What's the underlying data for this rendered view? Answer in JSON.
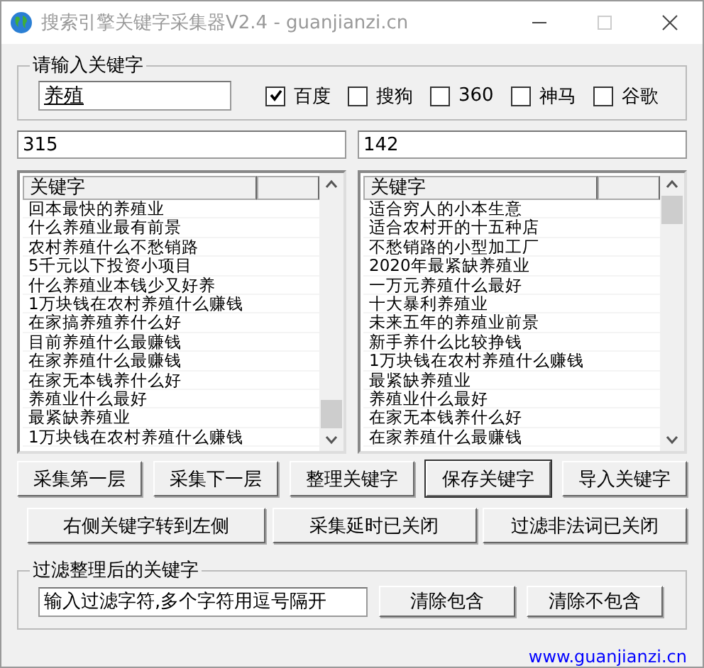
{
  "window": {
    "title": "搜索引擎关键字采集器V2.4 - guanjianzi.cn"
  },
  "keyword_group": {
    "legend": "请输入关键字",
    "value": "养殖",
    "engines": [
      {
        "label": "百度",
        "checked": true
      },
      {
        "label": "搜狗",
        "checked": false
      },
      {
        "label": "360",
        "checked": false
      },
      {
        "label": "神马",
        "checked": false
      },
      {
        "label": "谷歌",
        "checked": false
      }
    ]
  },
  "counts": [
    "315",
    "142"
  ],
  "lists": [
    {
      "column": "关键字",
      "rows": [
        "回本最快的养殖业",
        "什么养殖业最有前景",
        "农村养殖什么不愁销路",
        "5千元以下投资小项目",
        "什么养殖业本钱少又好养",
        "1万块钱在农村养殖什么赚钱",
        "在家搞养殖养什么好",
        "目前养殖什么最赚钱",
        "在家养殖什么最赚钱",
        "在家无本钱养什么好",
        "养殖业什么最好",
        "最紧缺养殖业",
        "1万块钱在农村养殖什么赚钱"
      ]
    },
    {
      "column": "关键字",
      "rows": [
        "适合穷人的小本生意",
        "适合农村开的十五种店",
        "不愁销路的小型加工厂",
        "2020年最紧缺养殖业",
        "一万元养殖什么最好",
        "十大暴利养殖业",
        "未来五年的养殖业前景",
        "新手养什么比较挣钱",
        "1万块钱在农村养殖什么赚钱",
        "最紧缺养殖业",
        "养殖业什么最好",
        "在家无本钱养什么好",
        "在家养殖什么最赚钱"
      ]
    }
  ],
  "button_rows": [
    [
      {
        "label": "采集第一层",
        "default": false
      },
      {
        "label": "采集下一层",
        "default": false
      },
      {
        "label": "整理关键字",
        "default": false
      },
      {
        "label": "保存关键字",
        "default": true
      },
      {
        "label": "导入关键字",
        "default": false
      }
    ],
    [
      {
        "label": "右侧关键字转到左侧",
        "default": false
      },
      {
        "label": "采集延时已关闭",
        "default": false
      },
      {
        "label": "过滤非法词已关闭",
        "default": false
      }
    ]
  ],
  "filter_group": {
    "legend": "过滤整理后的关键字",
    "value": "输入过滤字符,多个字符用逗号隔开",
    "buttons": [
      "清除包含",
      "清除不包含"
    ]
  },
  "footer_link": "www.guanjianzi.cn"
}
